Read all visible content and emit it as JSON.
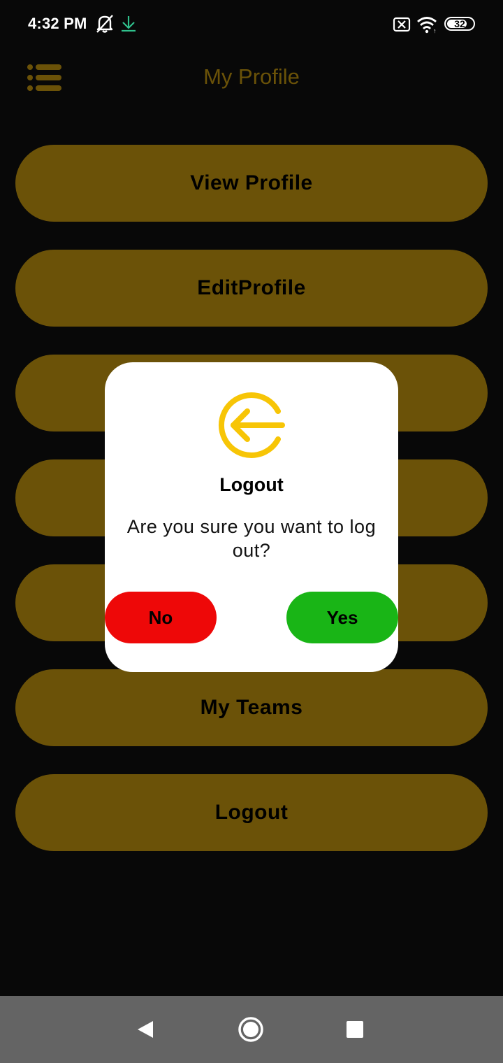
{
  "status_bar": {
    "time": "4:32 PM",
    "battery_level": "32"
  },
  "header": {
    "title": "My Profile",
    "menu_icon": "hamburger-list-icon"
  },
  "menu": {
    "items": [
      {
        "label": "View Profile"
      },
      {
        "label": "EditProfile"
      },
      {
        "label": ""
      },
      {
        "label": ""
      },
      {
        "label": ""
      },
      {
        "label": "My Teams"
      },
      {
        "label": "Logout"
      }
    ]
  },
  "dialog": {
    "icon": "logout-icon",
    "title": "Logout",
    "message": "Are you sure you want to log out?",
    "no_label": "No",
    "yes_label": "Yes"
  },
  "nav_bar": {
    "back_icon": "back-triangle-icon",
    "home_icon": "home-circle-icon",
    "recents_icon": "recents-square-icon"
  },
  "colors": {
    "background": "#080808",
    "accent_gold": "#6b5208",
    "icon_yellow": "#f7c506",
    "no_red": "#ee0808",
    "yes_green": "#19b516",
    "nav_gray": "#646464"
  }
}
